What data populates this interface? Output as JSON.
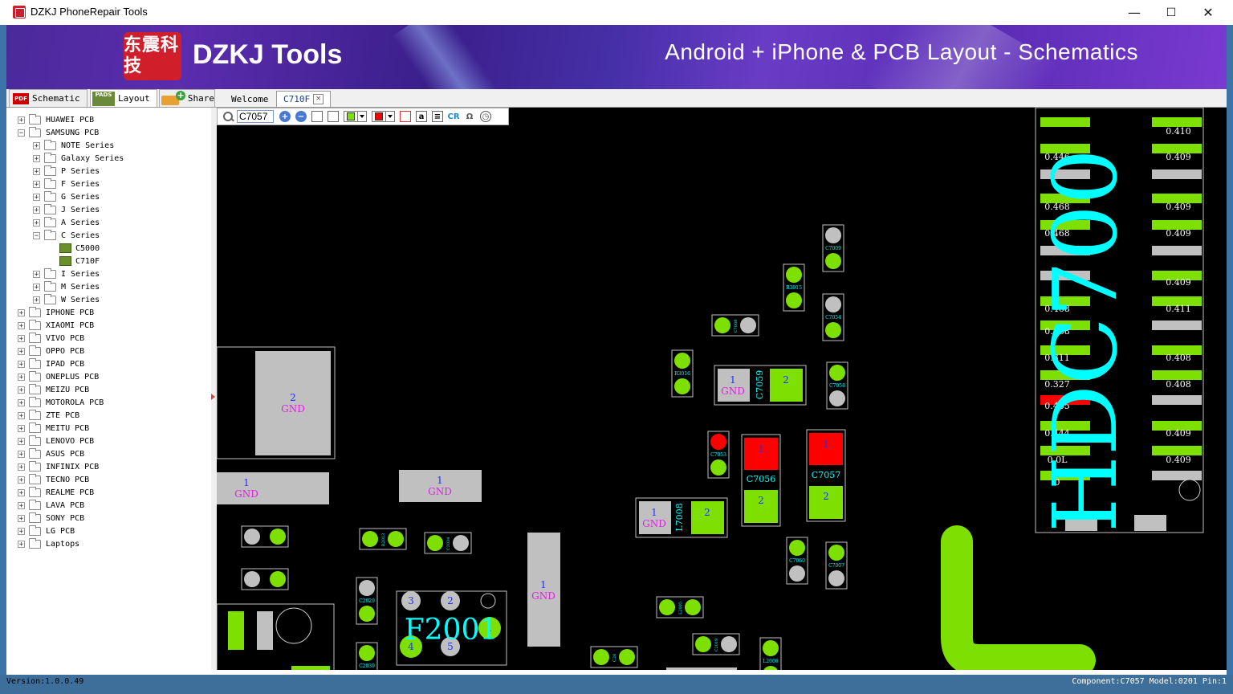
{
  "window": {
    "title": "DZKJ PhoneRepair Tools",
    "minimize": "—",
    "maximize": "☐",
    "close": "✕"
  },
  "banner": {
    "logo_chars": "东震科技",
    "logo_text": "DZKJ Tools",
    "tagline": "Android + iPhone & PCB Layout - Schematics"
  },
  "left_tabs": [
    {
      "icon": "PDF",
      "label": "Schematic"
    },
    {
      "icon": "PADS",
      "label": "Layout"
    },
    {
      "label": "Share"
    }
  ],
  "doc_tabs": [
    {
      "label": "Welcome"
    },
    {
      "label": "C710F"
    }
  ],
  "tree": [
    {
      "label": "HUAWEI PCB",
      "exp": "+"
    },
    {
      "label": "SAMSUNG PCB",
      "exp": "−"
    },
    {
      "label": "NOTE Series",
      "exp": "+"
    },
    {
      "label": "Galaxy Series",
      "exp": "+"
    },
    {
      "label": "P Series",
      "exp": "+"
    },
    {
      "label": "F Series",
      "exp": "+"
    },
    {
      "label": "G Series",
      "exp": "+"
    },
    {
      "label": "J Series",
      "exp": "+"
    },
    {
      "label": "A Series",
      "exp": "+"
    },
    {
      "label": "C Series",
      "exp": "−"
    },
    {
      "label": "C5000"
    },
    {
      "label": "C710F"
    },
    {
      "label": "I Series",
      "exp": "+"
    },
    {
      "label": "M Series",
      "exp": "+"
    },
    {
      "label": "W Series",
      "exp": "+"
    },
    {
      "label": "IPHONE PCB",
      "exp": "+"
    },
    {
      "label": "XIAOMI PCB",
      "exp": "+"
    },
    {
      "label": "VIVO PCB",
      "exp": "+"
    },
    {
      "label": "OPPO PCB",
      "exp": "+"
    },
    {
      "label": "IPAD PCB",
      "exp": "+"
    },
    {
      "label": "ONEPLUS PCB",
      "exp": "+"
    },
    {
      "label": "MEIZU PCB",
      "exp": "+"
    },
    {
      "label": "MOTOROLA PCB",
      "exp": "+"
    },
    {
      "label": "ZTE PCB",
      "exp": "+"
    },
    {
      "label": "MEITU PCB",
      "exp": "+"
    },
    {
      "label": "LENOVO PCB",
      "exp": "+"
    },
    {
      "label": "ASUS PCB",
      "exp": "+"
    },
    {
      "label": "INFINIX PCB",
      "exp": "+"
    },
    {
      "label": "TECNO PCB",
      "exp": "+"
    },
    {
      "label": "REALME PCB",
      "exp": "+"
    },
    {
      "label": "LAVA PCB",
      "exp": "+"
    },
    {
      "label": "SONY PCB",
      "exp": "+"
    },
    {
      "label": "LG PCB",
      "exp": "+"
    },
    {
      "label": "Laptops",
      "exp": "+"
    }
  ],
  "toolbar": {
    "search_value": "C7057",
    "zoom_in": "+",
    "zoom_out": "−",
    "cr": "CR",
    "omega": "Ω"
  },
  "colors": {
    "pad_green": "#7ee000",
    "pad_gray": "#c0c0c0",
    "highlight_red": "#ff0000",
    "label_cyan": "#00ffff",
    "net_blue": "#2030ff",
    "net_magenta": "#e020e0"
  },
  "pcb": {
    "ic_label": "HDC700",
    "ic_values_left": [
      "0.446",
      "0.468",
      "0.468",
      "0.468",
      "0.468",
      "0.311",
      "0.327",
      "0.435",
      "0.444",
      "0.0L",
      "0"
    ],
    "ic_values_right": [
      "0.410",
      "0.409",
      "0.409",
      "0.409",
      "0.409",
      "0.411",
      "0.408",
      "0.408",
      "0.409",
      "0.409"
    ],
    "gnd": "GND",
    "pin1": "1",
    "pin2": "2",
    "comp_c7059": "C7059",
    "comp_c7056": "C7056",
    "comp_c7057": "C7057",
    "comp_l7008": "L7008",
    "comp_f2001": "F2001",
    "f_pins": [
      "3",
      "2",
      "1",
      "4",
      "5"
    ],
    "tiny_labels": [
      "C7009",
      "R3015",
      "C7054",
      "R3016",
      "C7058",
      "C7053",
      "C7060",
      "C7007",
      "C2029",
      "C2039",
      "L2005",
      "R2013",
      "C2034",
      "C2019",
      "L2006",
      "C20",
      "C7008"
    ]
  },
  "status": {
    "version": "Version:1.0.0.49",
    "info": "Component:C7057 Model:0201 Pin:1"
  }
}
